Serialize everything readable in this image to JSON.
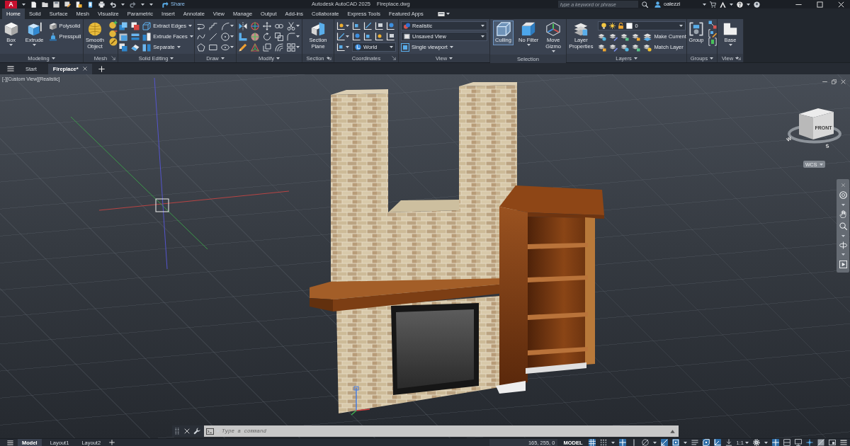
{
  "title_bar": {
    "app_logo": "A",
    "share_label": "Share",
    "app_title": "Autodesk AutoCAD 2025",
    "file_name": "Fireplace.dwg",
    "search": {
      "placeholder": "type a keyword or phrase"
    },
    "user_name": "oalezzi"
  },
  "ribbon_tabs": [
    {
      "label": "Home",
      "selected": true
    },
    {
      "label": "Solid",
      "selected": false
    },
    {
      "label": "Surface",
      "selected": false
    },
    {
      "label": "Mesh",
      "selected": false
    },
    {
      "label": "Visualize",
      "selected": false
    },
    {
      "label": "Parametric",
      "selected": false
    },
    {
      "label": "Insert",
      "selected": false
    },
    {
      "label": "Annotate",
      "selected": false
    },
    {
      "label": "View",
      "selected": false
    },
    {
      "label": "Manage",
      "selected": false
    },
    {
      "label": "Output",
      "selected": false
    },
    {
      "label": "Add-ins",
      "selected": false
    },
    {
      "label": "Collaborate",
      "selected": false
    },
    {
      "label": "Express Tools",
      "selected": false
    },
    {
      "label": "Featured Apps",
      "selected": false
    }
  ],
  "ribbon_panels": [
    {
      "title": "Modeling",
      "expandable": true,
      "launcher": false,
      "tools": [
        {
          "kind": "large",
          "label": "Box"
        },
        {
          "kind": "large",
          "label": "Extrude"
        },
        {
          "kind": "small",
          "label": "Polysolid"
        },
        {
          "kind": "small",
          "label": "Presspull"
        }
      ]
    },
    {
      "title": "Mesh",
      "expandable": false,
      "launcher": true,
      "tools": [
        {
          "kind": "large",
          "label": "Smooth Object"
        }
      ]
    },
    {
      "title": "Solid Editing",
      "expandable": true,
      "launcher": false,
      "tools": [
        {
          "kind": "small",
          "label": "Extract Edges"
        },
        {
          "kind": "small",
          "label": "Extrude Faces"
        },
        {
          "kind": "small",
          "label": "Separate"
        }
      ]
    },
    {
      "title": "Draw",
      "expandable": true,
      "launcher": false
    },
    {
      "title": "Modify",
      "expandable": true,
      "launcher": false
    },
    {
      "title": "Section",
      "expandable": true,
      "launcher": true,
      "tools": [
        {
          "kind": "large",
          "label": "Section Plane"
        }
      ]
    },
    {
      "title": "Coordinates",
      "expandable": false,
      "launcher": true,
      "tools": [
        {
          "kind": "dropdown",
          "value": "World"
        }
      ]
    },
    {
      "title": "View",
      "expandable": true,
      "launcher": false,
      "tools": [
        {
          "kind": "dropdown",
          "value": "Realistic"
        },
        {
          "kind": "dropdown",
          "value": "Unsaved View"
        },
        {
          "kind": "small",
          "label": "Single viewport"
        }
      ]
    },
    {
      "title": "Selection",
      "expandable": false,
      "launcher": false,
      "tools": [
        {
          "kind": "large",
          "label": "Culling",
          "on": true
        },
        {
          "kind": "large",
          "label": "No Filter",
          "on": false
        },
        {
          "kind": "large",
          "label": "Move Gizmo",
          "on": false
        }
      ]
    },
    {
      "title": "Layers",
      "expandable": true,
      "launcher": false,
      "tools": [
        {
          "kind": "large",
          "label": "Layer Properties"
        },
        {
          "kind": "dropdown",
          "value": "0"
        },
        {
          "kind": "small",
          "label": "Make Current"
        },
        {
          "kind": "small",
          "label": "Match Layer"
        }
      ]
    },
    {
      "title": "Groups",
      "expandable": true,
      "launcher": false,
      "tools": [
        {
          "kind": "large",
          "label": "Group"
        }
      ]
    },
    {
      "title": "View",
      "expandable": true,
      "launcher": true,
      "tools": [
        {
          "kind": "large",
          "label": "Base"
        }
      ]
    }
  ],
  "file_tabs": [
    {
      "label": "Start",
      "selected": false
    },
    {
      "label": "Fireplace*",
      "selected": true
    }
  ],
  "viewport": {
    "label": "[-][Custom View][Realistic]",
    "viewcube": {
      "face_label": "FRONT",
      "compass": [
        "W",
        "S"
      ]
    },
    "coordinate_system": "WCS"
  },
  "command_line": {
    "placeholder": "Type a command"
  },
  "layout_tabs": [
    {
      "label": "Model",
      "selected": true
    },
    {
      "label": "Layout1",
      "selected": false
    },
    {
      "label": "Layout2",
      "selected": false
    }
  ],
  "status_bar": {
    "coordinates": "165, 255, 0",
    "space": "MODEL",
    "toggles": [
      {
        "on": true
      },
      {
        "on": false
      },
      {
        "on": true
      },
      {
        "on": false
      },
      {
        "on": false
      },
      {
        "on": true
      },
      {
        "on": true
      },
      {
        "on": false
      },
      {
        "on": true
      },
      {
        "on": true
      },
      {
        "on": false
      }
    ],
    "annotation_scale": "1:1",
    "right_toggles": [
      {
        "on": true
      },
      {
        "on": false
      },
      {
        "on": false
      },
      {
        "on": false
      },
      {
        "on": false
      },
      {
        "on": false
      }
    ]
  }
}
